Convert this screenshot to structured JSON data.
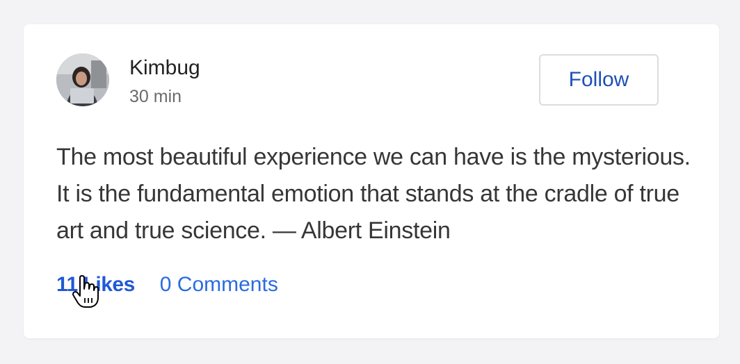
{
  "post": {
    "author_name": "Kimbug",
    "time": "30 min",
    "follow_label": "Follow",
    "text": "The most beautiful experience we can have is the mysterious. It is the fundamental emotion that stands at the cradle of true art and true science. — Albert Einstein",
    "likes_label": "11 Likes",
    "comments_label": "0 Comments"
  },
  "icons": {
    "avatar": "avatar-photo",
    "cursor": "hand-pointer-icon"
  },
  "colors": {
    "page_bg": "#f3f3f6",
    "card_bg": "#ffffff",
    "link": "#1f59d6",
    "follow_text": "#1f4fb8",
    "body_text": "#363636"
  }
}
